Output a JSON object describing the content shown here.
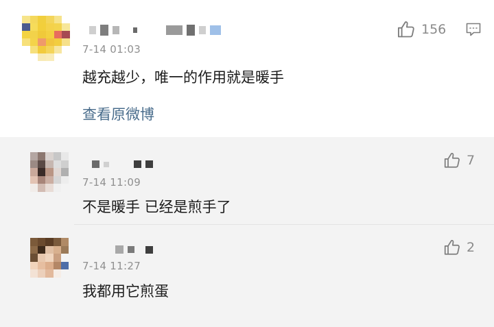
{
  "main_comment": {
    "time": "7-14 01:03",
    "text": "越充越少，唯一的作用就是暖手",
    "likes": "156",
    "view_original": "查看原微博"
  },
  "replies": [
    {
      "time": "7-14 11:09",
      "text": "不是暖手 已经是煎手了",
      "likes": "7"
    },
    {
      "time": "7-14 11:27",
      "text": "我都用它煎蛋",
      "likes": "2"
    }
  ],
  "icons": {
    "like": "thumbs-up-icon",
    "comment": "comment-icon"
  },
  "colors": {
    "link": "#4a6d8c",
    "timestamp": "#8f8f8f",
    "reply_background": "#f3f3f3"
  }
}
